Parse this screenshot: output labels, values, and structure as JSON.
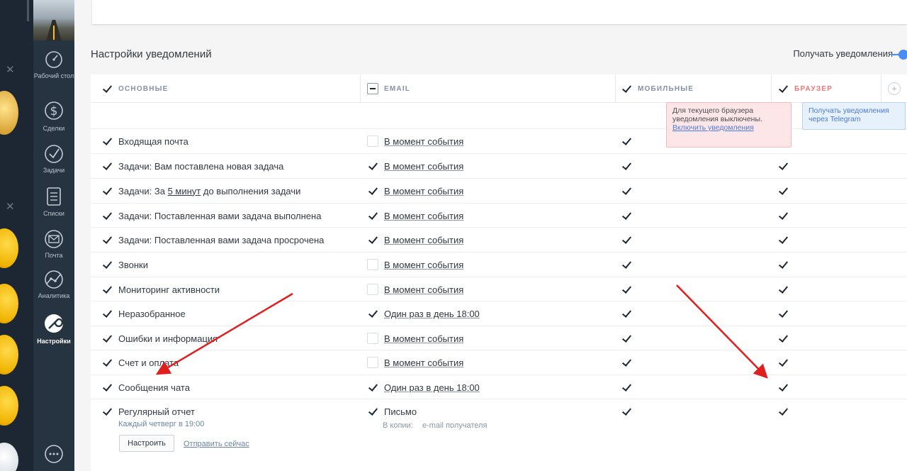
{
  "nav": {
    "items": [
      {
        "label": "Рабочий стол"
      },
      {
        "label": "Сделки"
      },
      {
        "label": "Задачи"
      },
      {
        "label": "Списки"
      },
      {
        "label": "Почта"
      },
      {
        "label": "Аналитика"
      },
      {
        "label": "Настройки"
      }
    ]
  },
  "page": {
    "section_title": "Настройки уведомлений",
    "receive_label": "Получать уведомления"
  },
  "columns": {
    "main": "ОСНОВНЫЕ",
    "email": "EMAIL",
    "mobile": "МОБИЛЬНЫЕ",
    "browser": "БРАУЗЕР"
  },
  "tooltips": {
    "browser_off_text": "Для текущего браузера уведомления выключены.",
    "browser_off_link": "Включить уведомления",
    "telegram": "Получать уведомления через Telegram"
  },
  "rows": [
    {
      "label": "Входящая почта",
      "email_checked": false,
      "email_freq": "В момент события"
    },
    {
      "label": "Задачи: Вам поставлена новая задача",
      "email_checked": true,
      "email_freq": "В момент события"
    },
    {
      "label_pre": "Задачи: За ",
      "label_link": "5 минут",
      "label_post": " до выполнения задачи",
      "email_checked": true,
      "email_freq": "В момент события"
    },
    {
      "label": "Задачи: Поставленная вами задача выполнена",
      "email_checked": true,
      "email_freq": "В момент события"
    },
    {
      "label": "Задачи: Поставленная вами задача просрочена",
      "email_checked": true,
      "email_freq": "В момент события"
    },
    {
      "label": "Звонки",
      "email_checked": false,
      "email_freq": "В момент события"
    },
    {
      "label": "Мониторинг активности",
      "email_checked": false,
      "email_freq": "В момент события"
    },
    {
      "label": "Неразобранное",
      "email_checked": true,
      "email_freq": "Один раз в день 18:00"
    },
    {
      "label": "Ошибки и информация",
      "email_checked": false,
      "email_freq": "В момент события"
    },
    {
      "label": "Счет и оплата",
      "email_checked": false,
      "email_freq": "В момент события"
    },
    {
      "label": "Сообщения чата",
      "email_checked": true,
      "email_freq": "Один раз в день 18:00"
    },
    {
      "label": "Регулярный отчет",
      "email_checked": true,
      "email_freq": "Письмо"
    }
  ],
  "report": {
    "schedule": "Каждый четверг в 19:00",
    "copy_label": "В копии:",
    "copy_value": "e-mail получателя",
    "configure_button": "Настроить",
    "send_now_link": "Отправить сейчас"
  },
  "colors": {
    "sidebar": "#263340",
    "accent_blue": "#4c8bf5",
    "browser_header": "#f37575",
    "arrow": "#e01e1e"
  }
}
